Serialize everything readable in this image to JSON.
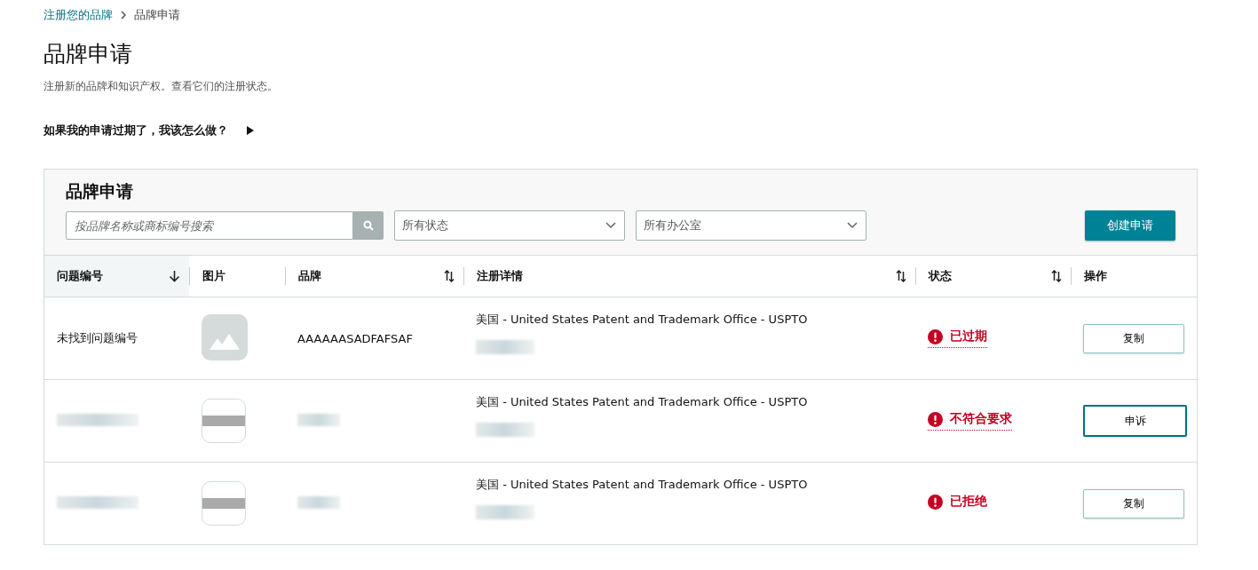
{
  "breadcrumb": [
    {
      "label": "注册您的品牌",
      "link": true
    },
    {
      "label": "品牌申请",
      "link": false
    }
  ],
  "title": "品牌申请",
  "subtitle": "注册新的品牌和知识产权。查看它们的注册状态。",
  "faq": {
    "label": "如果我的申请过期了，我该怎么做？",
    "expanded": false
  },
  "card": {
    "title": "品牌申请",
    "search": {
      "placeholder": "按品牌名称或商标编号搜索"
    },
    "filters": [
      {
        "value": "所有状态"
      },
      {
        "value": "所有办公室"
      }
    ],
    "create_button": "创建申请",
    "columns": [
      {
        "label": "问题编号",
        "sortable": true,
        "sorted": true
      },
      {
        "label": "图片",
        "sortable": false,
        "sorted": false
      },
      {
        "label": "品牌",
        "sortable": true,
        "sorted": false
      },
      {
        "label": "注册详情",
        "sortable": true,
        "sorted": false
      },
      {
        "label": "状态",
        "sortable": true,
        "sorted": false
      },
      {
        "label": "操作",
        "sortable": false,
        "sorted": false
      }
    ],
    "rows": [
      {
        "redacted": false,
        "issue_id": "未找到问题编号",
        "brand": "AAAAAASADFAFSAF",
        "office": "美国 - United States Patent and Trademark Office - USPTO",
        "status": "已过期",
        "status_underlined": true,
        "action": "复制",
        "focused": false
      },
      {
        "redacted": true,
        "office": "美国 - United States Patent and Trademark Office - USPTO",
        "status": "不符合要求",
        "status_underlined": true,
        "action": "申诉",
        "focused": true
      },
      {
        "redacted": true,
        "office": "美国 - United States Patent and Trademark Office - USPTO",
        "status": "已拒绝",
        "status_underlined": false,
        "action": "复制",
        "focused": false
      }
    ]
  }
}
